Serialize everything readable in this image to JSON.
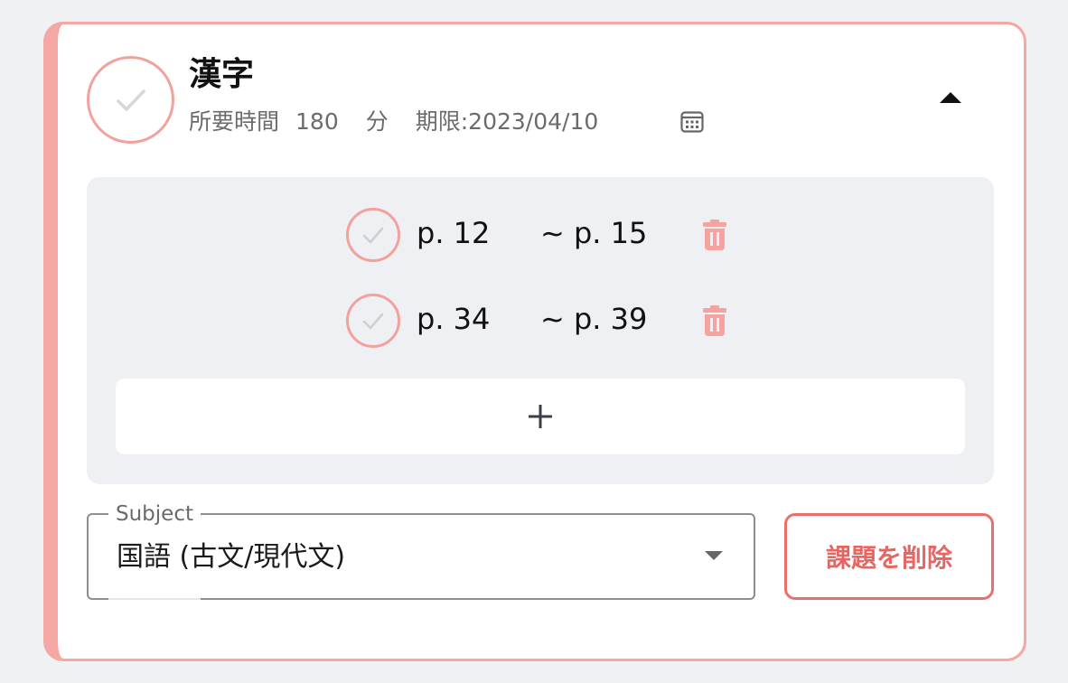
{
  "task": {
    "title": "漢字",
    "required_time_label": "所要時間",
    "required_time_value": "180",
    "required_time_unit": "分",
    "deadline": "期限:2023/04/10",
    "completed": false,
    "expanded": true
  },
  "ranges": [
    {
      "from": "p. 12",
      "to": "~ p. 15",
      "completed": false
    },
    {
      "from": "p. 34",
      "to": "~ p. 39",
      "completed": false
    }
  ],
  "add_range_symbol": "+",
  "subject": {
    "label": "Subject",
    "value": "国語 (古文/現代文)"
  },
  "delete_task_label": "課題を削除",
  "icons": {
    "task_check": "check-icon",
    "calendar": "calendar-icon",
    "collapse": "triangle-up-icon",
    "range_check": "check-icon",
    "range_delete": "trash-icon",
    "add": "plus-icon",
    "dropdown": "triangle-down-icon"
  },
  "colors": {
    "accent_border": "#f4a7a3",
    "check_ring": "#f2a29d",
    "trash": "#f4a3a1",
    "delete_button": "#ea6f6c",
    "panel_bg": "#eff0f3"
  }
}
